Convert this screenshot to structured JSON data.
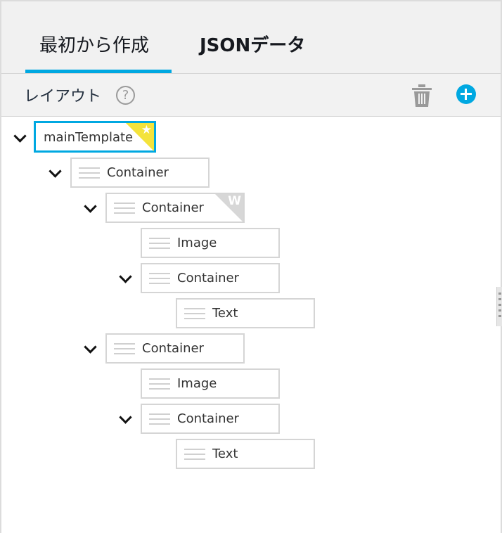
{
  "tabs": [
    {
      "label": "最初から作成",
      "active": true
    },
    {
      "label": "JSONデータ",
      "active": false
    }
  ],
  "layout_panel": {
    "title": "レイアウト",
    "help_glyph": "?",
    "accent_color": "#00a8e1"
  },
  "tree": {
    "root": {
      "label": "mainTemplate",
      "badge": "star"
    },
    "nodes": [
      {
        "label": "Container"
      },
      {
        "label": "Container",
        "badge": "W"
      },
      {
        "label": "Image"
      },
      {
        "label": "Container"
      },
      {
        "label": "Text"
      },
      {
        "label": "Container"
      },
      {
        "label": "Image"
      },
      {
        "label": "Container"
      },
      {
        "label": "Text"
      }
    ]
  }
}
